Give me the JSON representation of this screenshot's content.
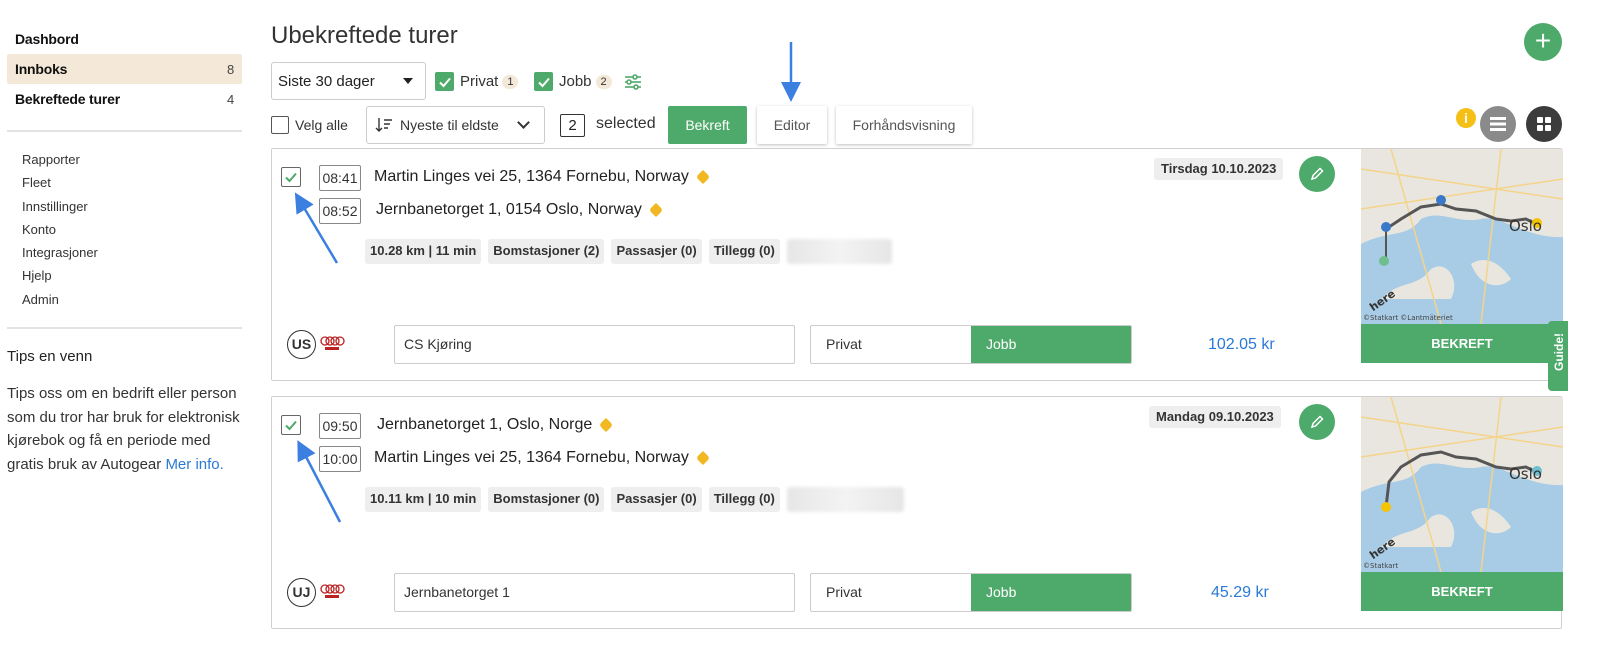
{
  "sidebar": {
    "nav": [
      {
        "label": "Dashbord",
        "count": ""
      },
      {
        "label": "Innboks",
        "count": "8"
      },
      {
        "label": "Bekreftede turer",
        "count": "4"
      }
    ],
    "sub": [
      "Rapporter",
      "Fleet",
      "Innstillinger",
      "Konto",
      "Integrasjoner",
      "Hjelp",
      "Admin"
    ],
    "tips_title": "Tips en venn",
    "tips_text": "Tips oss om en bedrift eller person som du tror har bruk for elektronisk kjørebok og få en periode med gratis bruk av Autogear",
    "tips_link": "Mer info."
  },
  "header": {
    "title": "Ubekreftede turer",
    "range": "Siste 30 dager",
    "filters": [
      {
        "label": "Privat",
        "badge": "1"
      },
      {
        "label": "Jobb",
        "badge": "2"
      }
    ]
  },
  "toolbar": {
    "select_all": "Velg alle",
    "sort": "Nyeste til eldste",
    "selected_count": "2",
    "selected_label": "selected",
    "confirm": "Bekreft",
    "editor": "Editor",
    "preview": "Forhåndsvisning"
  },
  "trips": [
    {
      "checked": true,
      "start_time": "08:41",
      "start_address": "Martin Linges vei 25, 1364 Fornebu, Norway",
      "end_time": "08:52",
      "end_address": "Jernbanetorget 1, 0154 Oslo, Norway",
      "chips": [
        "10.28 km | 11 min",
        "Bomstasjoner (2)",
        "Passasjer (0)",
        "Tillegg (0)"
      ],
      "date": "Tirsdag 10.10.2023",
      "initials": "US",
      "description": "CS Kjøring",
      "options": [
        "Privat",
        "Jobb"
      ],
      "selected_option": "Jobb",
      "price": "102.05 kr",
      "confirm": "BEKREFT"
    },
    {
      "checked": true,
      "start_time": "09:50",
      "start_address": "Jernbanetorget 1, Oslo, Norge",
      "end_time": "10:00",
      "end_address": "Martin Linges vei 25, 1364 Fornebu, Norway",
      "chips": [
        "10.11 km | 10 min",
        "Bomstasjoner (0)",
        "Passasjer (0)",
        "Tillegg (0)"
      ],
      "date": "Mandag 09.10.2023",
      "initials": "UJ",
      "description": "Jernbanetorget 1",
      "options": [
        "Privat",
        "Jobb"
      ],
      "selected_option": "Jobb",
      "price": "45.29 kr",
      "confirm": "BEKREFT"
    }
  ],
  "map": {
    "city_label": "Oslo",
    "attribution": "©Statkart ©Lantmäteriet",
    "logo": "here"
  },
  "guide_tab": "Guide!",
  "colors": {
    "accent": "#4eaa6a",
    "link": "#2a7ad6",
    "active_nav": "#f4e9d8",
    "arrow": "#3b7fe0"
  }
}
